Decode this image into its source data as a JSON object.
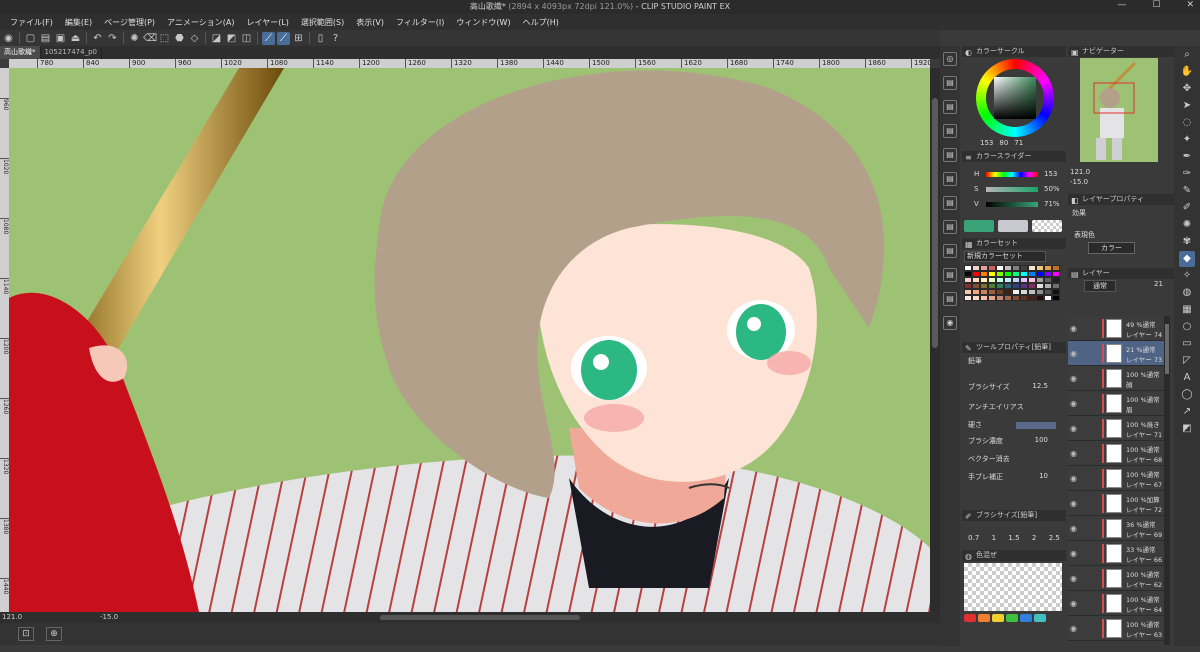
{
  "window": {
    "title": "高山歌織*",
    "title_detail": "(2894 x 4093px 72dpi 121.0%)",
    "app": " - CLIP STUDIO PAINT EX"
  },
  "menu": [
    "ファイル(F)",
    "編集(E)",
    "ページ管理(P)",
    "アニメーション(A)",
    "レイヤー(L)",
    "選択範囲(S)",
    "表示(V)",
    "フィルター(I)",
    "ウィンドウ(W)",
    "ヘルプ(H)"
  ],
  "tabs": [
    "高山歌織*",
    "105217474_p0"
  ],
  "ruler": {
    "top": [
      "780",
      "840",
      "900",
      "960",
      "1020",
      "1080",
      "1140",
      "1200",
      "1260",
      "1320",
      "1380",
      "1440",
      "1500",
      "1560",
      "1620",
      "1680",
      "1740",
      "1800",
      "1860",
      "1920"
    ],
    "left": [
      "960",
      "1020",
      "1080",
      "1140",
      "1200",
      "1260",
      "1320",
      "1380",
      "1440",
      "1500"
    ]
  },
  "status": {
    "zoom": "121.0",
    "angle": "-15.0"
  },
  "color_panel": {
    "title": "カラーサークル",
    "values": [
      "153",
      "80",
      "71"
    ],
    "main_color": "#3aa37a",
    "sub_color": "#c8c8d0"
  },
  "slider_panel": {
    "title": "カラースライダー",
    "rows": [
      {
        "label": "H",
        "value": "153"
      },
      {
        "label": "S",
        "value": "50%"
      },
      {
        "label": "V",
        "value": "71%"
      }
    ]
  },
  "colorset_panel": {
    "title": "カラーセット",
    "selected": "新規カラーセット",
    "palette": [
      "#ffffff",
      "#f0d0c8",
      "#e8a0a0",
      "#d06060",
      "#ffffff",
      "#c0c0c0",
      "#808080",
      "#404040",
      "#f8e8c8",
      "#f0c880",
      "#e8a040",
      "#c07020",
      "#000000",
      "#ff0000",
      "#ff8000",
      "#ffff00",
      "#80ff00",
      "#00ff00",
      "#00ff80",
      "#00ffff",
      "#0080ff",
      "#0000ff",
      "#8000ff",
      "#ff00ff",
      "#ffd0d0",
      "#ffe0c0",
      "#fff0c0",
      "#e0ffc0",
      "#c0ffe0",
      "#c0f0ff",
      "#c0d0ff",
      "#e0c0ff",
      "#ffc0e0",
      "#a0a0a0",
      "#606060",
      "#202020",
      "#803030",
      "#805030",
      "#807030",
      "#508030",
      "#308060",
      "#306080",
      "#304080",
      "#603080",
      "#803060",
      "#e0e0e0",
      "#b0b0b0",
      "#707070",
      "#f8c8a8",
      "#f0a880",
      "#d08060",
      "#a06040",
      "#704020",
      "#402010",
      "#f0f0f0",
      "#d8d8d8",
      "#c0c0c0",
      "#909090",
      "#505050",
      "#101010",
      "#ffe8e0",
      "#ffd8c8",
      "#f8c0a8",
      "#e8a890",
      "#c88870",
      "#a06850",
      "#884838",
      "#603020",
      "#402018",
      "#201008",
      "#ffffff",
      "#000000"
    ]
  },
  "tool_property": {
    "title": "ツールプロパティ[鉛筆]",
    "tool_name": "鉛筆",
    "brush_size_label": "ブラシサイズ",
    "brush_size": "12.5",
    "antialias_label": "アンチエイリアス",
    "hardness_label": "硬さ",
    "density_label": "ブラシ濃度",
    "density": "100",
    "vector_label": "ベクター消去",
    "stabilizer_label": "手ブレ補正",
    "stabilizer": "10"
  },
  "brush_size_panel": {
    "title": "ブラシサイズ[鉛筆]",
    "sizes": [
      "0.7",
      "1",
      "1.5",
      "2",
      "2.5"
    ]
  },
  "subview_panel": {
    "title": "色混ぜ",
    "colors": [
      "#e03030",
      "#f08030",
      "#f0d030",
      "#40c040",
      "#3080e0",
      "#40c0c0"
    ]
  },
  "navigator": {
    "title": "ナビゲーター",
    "zoom": "121.0",
    "angle": "-15.0"
  },
  "layer_property": {
    "title": "レイヤープロパティ",
    "effect_label": "効果",
    "express_label": "表現色",
    "express_value": "カラー"
  },
  "layers": {
    "title": "レイヤー",
    "blend_mode": "通常",
    "opacity": "21",
    "rows": [
      {
        "mode": "49 %通常",
        "name": "レイヤー 74",
        "selected": false
      },
      {
        "mode": "21 %通常",
        "name": "レイヤー 73",
        "selected": true
      },
      {
        "mode": "100 %通常",
        "name": "顔",
        "selected": false
      },
      {
        "mode": "100 %通常",
        "name": "眉",
        "selected": false
      },
      {
        "mode": "100 %焼き",
        "name": "レイヤー 71",
        "selected": false
      },
      {
        "mode": "100 %通常",
        "name": "レイヤー 68",
        "selected": false
      },
      {
        "mode": "100 %通常",
        "name": "レイヤー 67",
        "selected": false
      },
      {
        "mode": "100 %加算",
        "name": "レイヤー 72",
        "selected": false
      },
      {
        "mode": "36 %通常",
        "name": "レイヤー 69",
        "selected": false
      },
      {
        "mode": "33 %通常",
        "name": "レイヤー 66",
        "selected": false
      },
      {
        "mode": "100 %通常",
        "name": "レイヤー 62",
        "selected": false
      },
      {
        "mode": "100 %通常",
        "name": "レイヤー 64",
        "selected": false
      },
      {
        "mode": "100 %通常",
        "name": "レイヤー 63",
        "selected": false
      }
    ]
  }
}
